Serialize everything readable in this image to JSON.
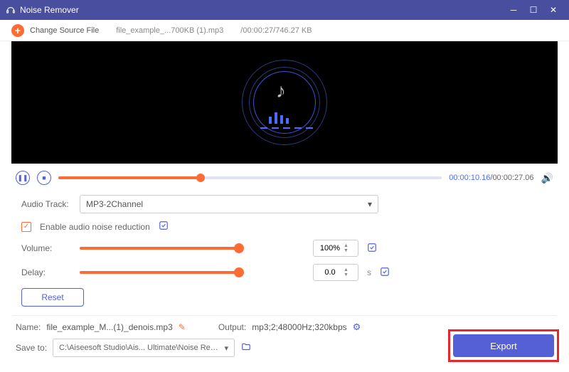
{
  "titlebar": {
    "title": "Noise Remover"
  },
  "topbar": {
    "change_label": "Change Source File",
    "filename": "file_example_...700KB (1).mp3",
    "meta": "/00:00:27/746.27 KB"
  },
  "playback": {
    "current": "00:00:10.16",
    "total": "00:00:27.06",
    "progress_pct": 37
  },
  "audio_track": {
    "label": "Audio Track:",
    "value": "MP3-2Channel"
  },
  "noise": {
    "label": "Enable audio noise reduction",
    "checked": true
  },
  "volume": {
    "label": "Volume:",
    "value": "100%",
    "pct": 100
  },
  "delay": {
    "label": "Delay:",
    "value": "0.0",
    "unit": "s",
    "pct": 100
  },
  "reset": {
    "label": "Reset"
  },
  "name": {
    "label": "Name:",
    "value": "file_example_M...(1)_denois.mp3"
  },
  "output": {
    "label": "Output:",
    "value": "mp3;2;48000Hz;320kbps"
  },
  "saveto": {
    "label": "Save to:",
    "value": "C:\\Aiseesoft Studio\\Ais... Ultimate\\Noise Remover"
  },
  "export": {
    "label": "Export"
  }
}
